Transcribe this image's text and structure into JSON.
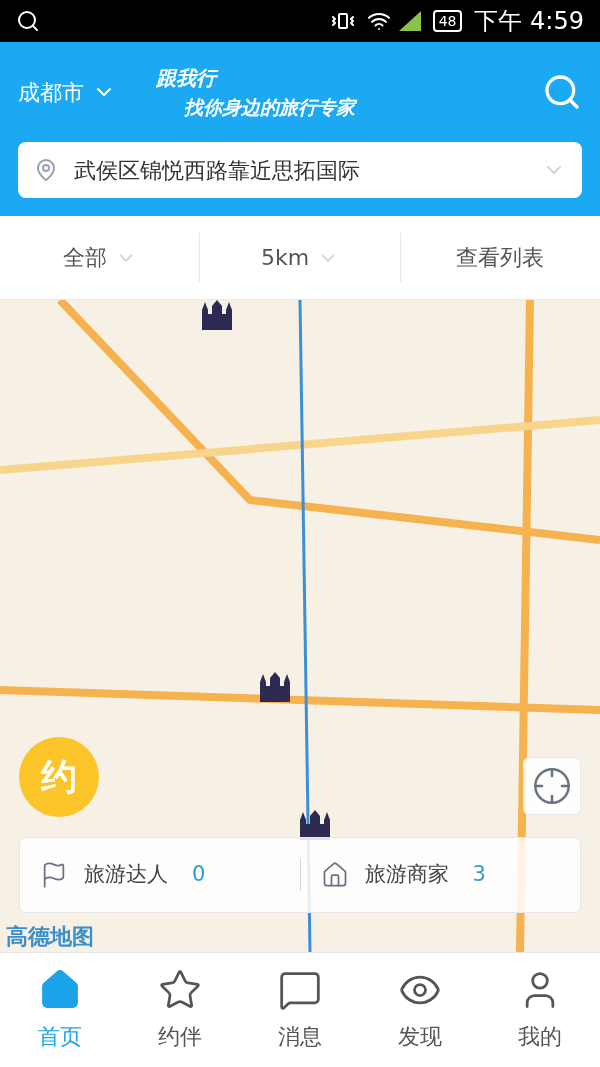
{
  "status_bar": {
    "battery": "48",
    "time": "下午 4:59"
  },
  "header": {
    "city": "成都市",
    "title": "跟我行",
    "slogan": "找你身边的旅行专家"
  },
  "location": {
    "text": "武侯区锦悦西路靠近思拓国际"
  },
  "filters": [
    {
      "label": "全部",
      "kind": "dropdown"
    },
    {
      "label": "5km",
      "kind": "dropdown"
    },
    {
      "label": "查看列表",
      "kind": "link"
    }
  ],
  "map": {
    "badge": "约",
    "logo": "高德地图"
  },
  "legend": [
    {
      "label": "旅游达人",
      "count": "0",
      "kind": "flag"
    },
    {
      "label": "旅游商家",
      "count": "3",
      "kind": "house"
    }
  ],
  "tabs": [
    {
      "label": "首页",
      "kind": "home",
      "selected": true
    },
    {
      "label": "约伴",
      "kind": "star",
      "selected": false
    },
    {
      "label": "消息",
      "kind": "message",
      "selected": false
    },
    {
      "label": "发现",
      "kind": "eye",
      "selected": false
    },
    {
      "label": "我的",
      "kind": "user",
      "selected": false
    }
  ]
}
